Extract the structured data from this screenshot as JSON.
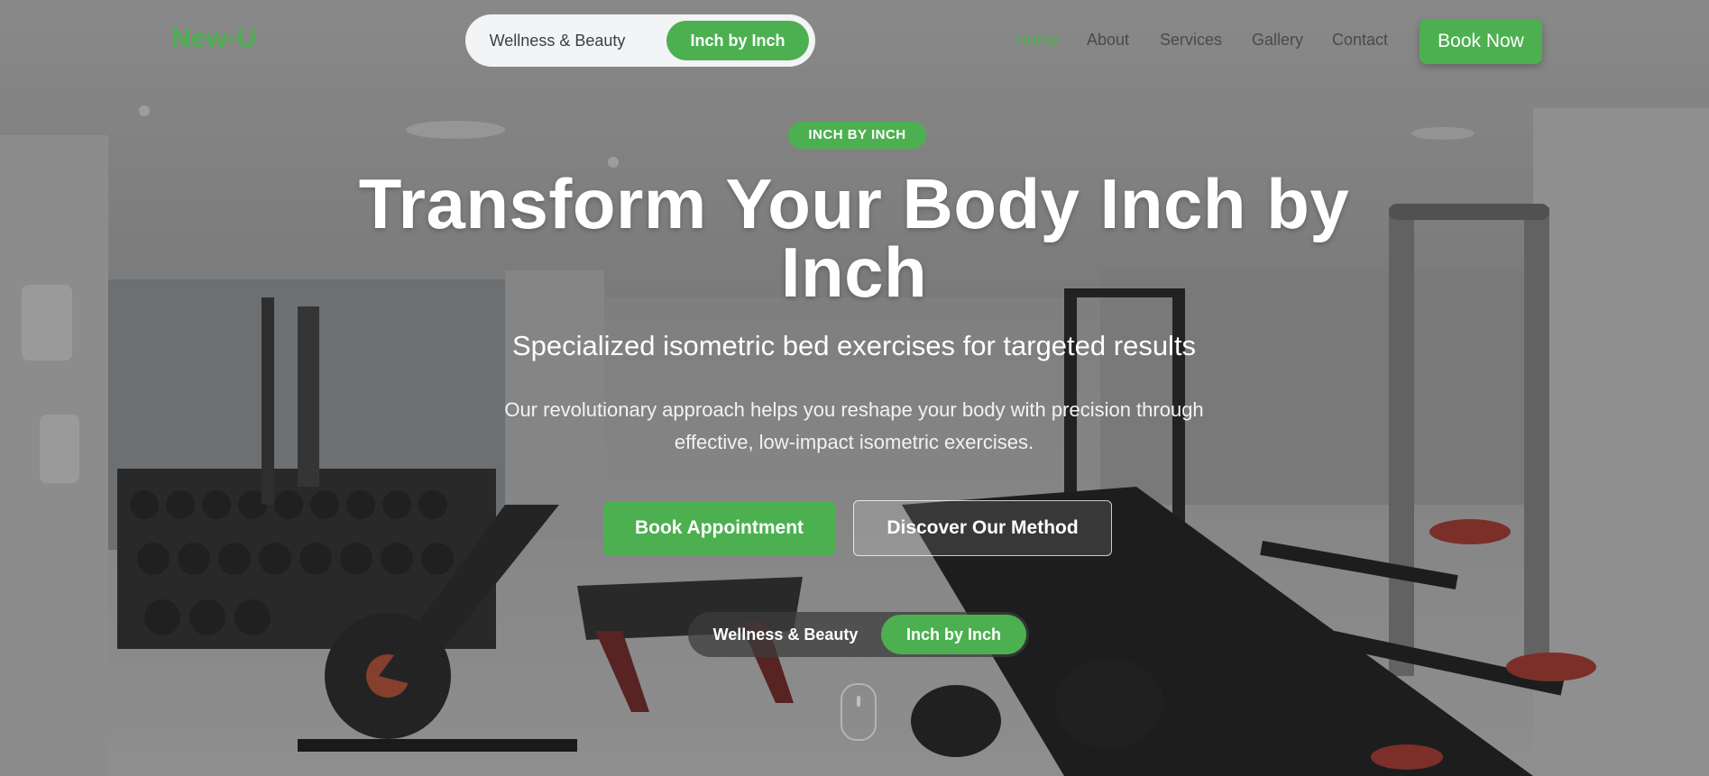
{
  "header": {
    "logo": "New-U",
    "switch": {
      "left_label": "Wellness & Beauty",
      "right_label": "Inch by Inch",
      "active": "Inch by Inch"
    },
    "nav": [
      {
        "label": "Home",
        "active": true
      },
      {
        "label": "About",
        "active": false
      },
      {
        "label": "Services",
        "active": false
      },
      {
        "label": "Gallery",
        "active": false
      },
      {
        "label": "Contact",
        "active": false
      }
    ],
    "cta_label": "Book Now"
  },
  "hero": {
    "badge": "INCH BY INCH",
    "title": "Transform Your Body Inch by Inch",
    "subtitle": "Specialized isometric bed exercises for targeted results",
    "description": "Our revolutionary approach helps you reshape your body with precision through effective, low-impact isometric exercises.",
    "primary_button": "Book Appointment",
    "secondary_button": "Discover Our Method",
    "switch": {
      "left_label": "Wellness & Beauty",
      "right_label": "Inch by Inch",
      "active": "Inch by Inch"
    },
    "scroll_icon": "mouse-scroll-icon"
  },
  "colors": {
    "accent": "#4cb050",
    "nav_text": "#4a4a4a",
    "overlay": "rgba(40,40,40,0.42)"
  }
}
